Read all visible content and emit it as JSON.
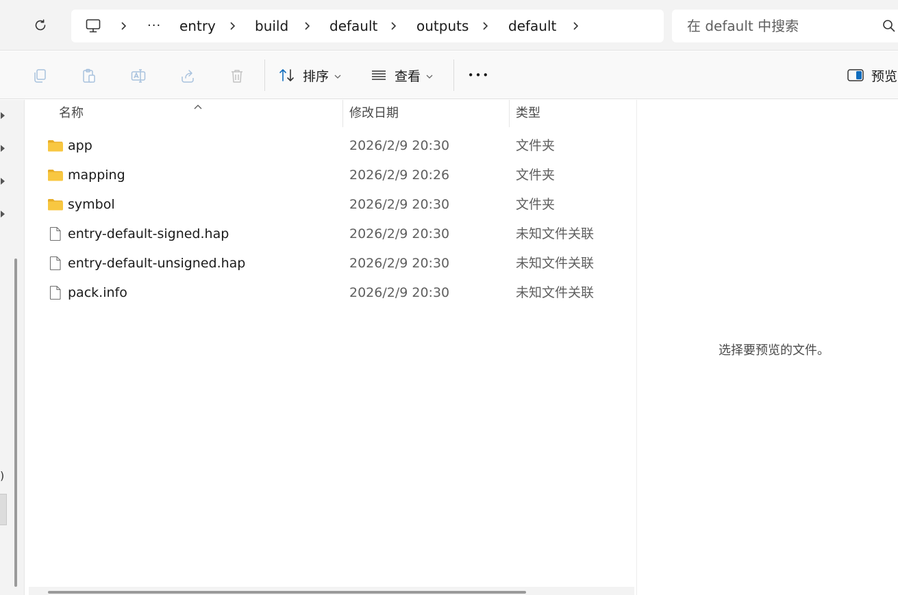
{
  "address_bar": {
    "breadcrumbs": [
      "entry",
      "build",
      "default",
      "outputs",
      "default"
    ],
    "overflow_label": "···",
    "search_placeholder": "在 default 中搜索"
  },
  "command_bar": {
    "sort_label": "排序",
    "view_label": "查看",
    "more_label": "•••",
    "preview_label": "预览"
  },
  "nav": {
    "paren_text": ")"
  },
  "file_list": {
    "columns": {
      "name": "名称",
      "modified": "修改日期",
      "type": "类型"
    },
    "items": [
      {
        "name": "app",
        "modified": "2026/2/9 20:30",
        "type": "文件夹",
        "icon": "folder-icon"
      },
      {
        "name": "mapping",
        "modified": "2026/2/9 20:26",
        "type": "文件夹",
        "icon": "folder-icon"
      },
      {
        "name": "symbol",
        "modified": "2026/2/9 20:30",
        "type": "文件夹",
        "icon": "folder-icon"
      },
      {
        "name": "entry-default-signed.hap",
        "modified": "2026/2/9 20:30",
        "type": "未知文件关联",
        "icon": "file-icon"
      },
      {
        "name": "entry-default-unsigned.hap",
        "modified": "2026/2/9 20:30",
        "type": "未知文件关联",
        "icon": "file-icon"
      },
      {
        "name": "pack.info",
        "modified": "2026/2/9 20:30",
        "type": "未知文件关联",
        "icon": "file-icon"
      }
    ]
  },
  "preview": {
    "message": "选择要预览的文件。"
  },
  "colors": {
    "accent": "#0f6cbd",
    "folder": "#f8c741"
  }
}
